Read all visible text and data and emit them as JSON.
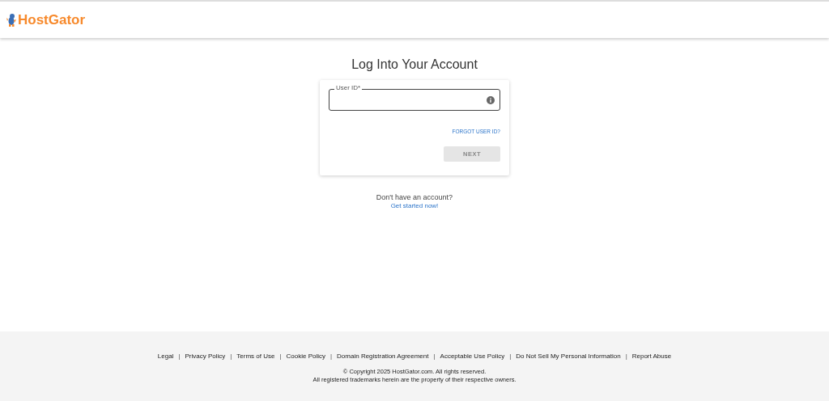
{
  "header": {
    "logo": "HostGator"
  },
  "title": "Log Into Your Account",
  "login_card": {
    "user_id_field": {
      "label": "User ID*"
    },
    "forgot_link": "FORGOT USER ID?",
    "next_button": {
      "label": "NEXT",
      "disabled": true
    }
  },
  "signup": {
    "prompt": "Don't have an account?",
    "link": "Get started now!"
  },
  "footer": {
    "links": [
      "Legal",
      "Privacy Policy",
      "Terms of Use",
      "Cookie Policy",
      "Domain Registration Agreement",
      "Acceptable Use Policy",
      "Do Not Sell My Personal Information",
      "Report Abuse"
    ],
    "separator": "|",
    "copyright": "© Copyright 2025 HostGator.com. All rights reserved.",
    "trademarks": "All registered trademarks herein are the property of their respective owners."
  }
}
